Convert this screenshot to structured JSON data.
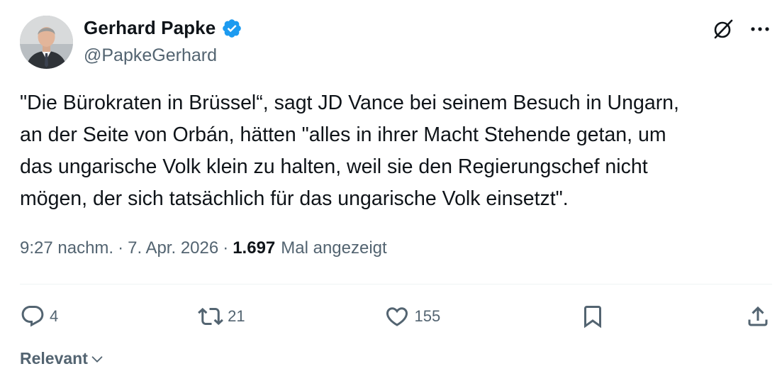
{
  "author": {
    "name": "Gerhard Papke",
    "handle": "@PapkeGerhard",
    "avatar_icon": "profile-photo"
  },
  "tweet": {
    "text": "\"Die Bürokraten in Brüssel“, sagt JD Vance bei seinem Besuch in Ungarn,\nan der Seite von Orbán, hätten \"alles in ihrer Macht Stehende getan, um\ndas ungarische Volk klein zu halten, weil sie den Regierungschef nicht\nmögen, der sich tatsächlich für das ungarische Volk einsetzt\"."
  },
  "meta": {
    "time": "9:27 nachm.",
    "date": "7. Apr. 2026",
    "separator": "·",
    "views_count": "1.697",
    "views_label": "Mal angezeigt"
  },
  "actions": {
    "replies": "4",
    "retweets": "21",
    "likes": "155"
  },
  "sort": {
    "label": "Relevant"
  },
  "colors": {
    "verified": "#1d9bf0",
    "muted": "#536471",
    "text": "#0f1419",
    "divider": "#eff3f4"
  }
}
